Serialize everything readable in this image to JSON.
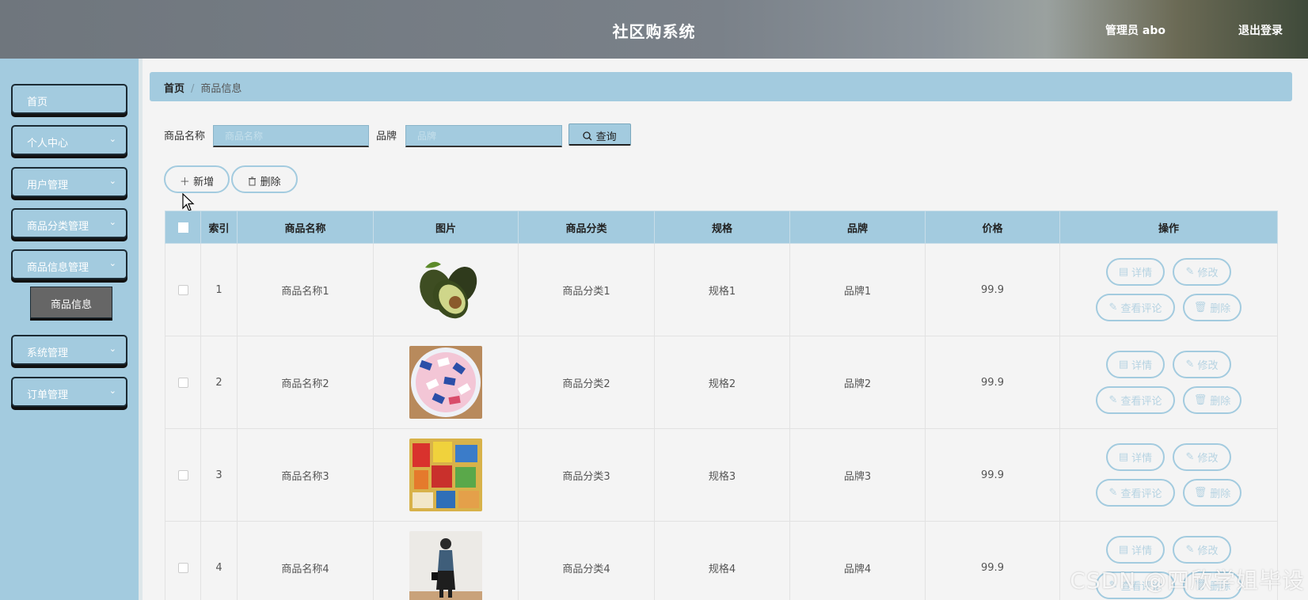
{
  "header": {
    "title": "社区购系统",
    "user": "管理员 abo",
    "logout": "退出登录"
  },
  "sidebar": {
    "items": [
      {
        "label": "首页"
      },
      {
        "label": "个人中心"
      },
      {
        "label": "用户管理"
      },
      {
        "label": "商品分类管理"
      },
      {
        "label": "商品信息管理"
      },
      {
        "label": "系统管理"
      },
      {
        "label": "订单管理"
      }
    ],
    "active_sub": "商品信息"
  },
  "breadcrumb": {
    "home": "首页",
    "separator": "/",
    "current": "商品信息"
  },
  "search": {
    "name_label": "商品名称",
    "name_placeholder": "商品名称",
    "brand_label": "品牌",
    "brand_placeholder": "品牌",
    "query_label": "查询"
  },
  "actions": {
    "add_label": "新增",
    "delete_label": "删除"
  },
  "table": {
    "headers": [
      "索引",
      "商品名称",
      "图片",
      "商品分类",
      "规格",
      "品牌",
      "价格",
      "操作"
    ],
    "rows": [
      {
        "index": "1",
        "name": "商品名称1",
        "image": "avocado",
        "category": "商品分类1",
        "spec": "规格1",
        "brand": "品牌1",
        "price": "99.9"
      },
      {
        "index": "2",
        "name": "商品名称2",
        "image": "candy-bowl",
        "category": "商品分类2",
        "spec": "规格2",
        "brand": "品牌2",
        "price": "99.9"
      },
      {
        "index": "3",
        "name": "商品名称3",
        "image": "snacks",
        "category": "商品分类3",
        "spec": "规格3",
        "brand": "品牌3",
        "price": "99.9"
      },
      {
        "index": "4",
        "name": "商品名称4",
        "image": "clothing-model",
        "category": "商品分类4",
        "spec": "规格4",
        "brand": "品牌4",
        "price": "99.9"
      }
    ],
    "row_actions": {
      "detail": "详情",
      "edit": "修改",
      "comments": "查看评论",
      "delete": "删除"
    }
  },
  "watermark": "CSDN @四欣学姐毕设",
  "colors": {
    "accent": "#a3cbdf",
    "header": "#7a8189",
    "submenu_active": "#666666"
  }
}
